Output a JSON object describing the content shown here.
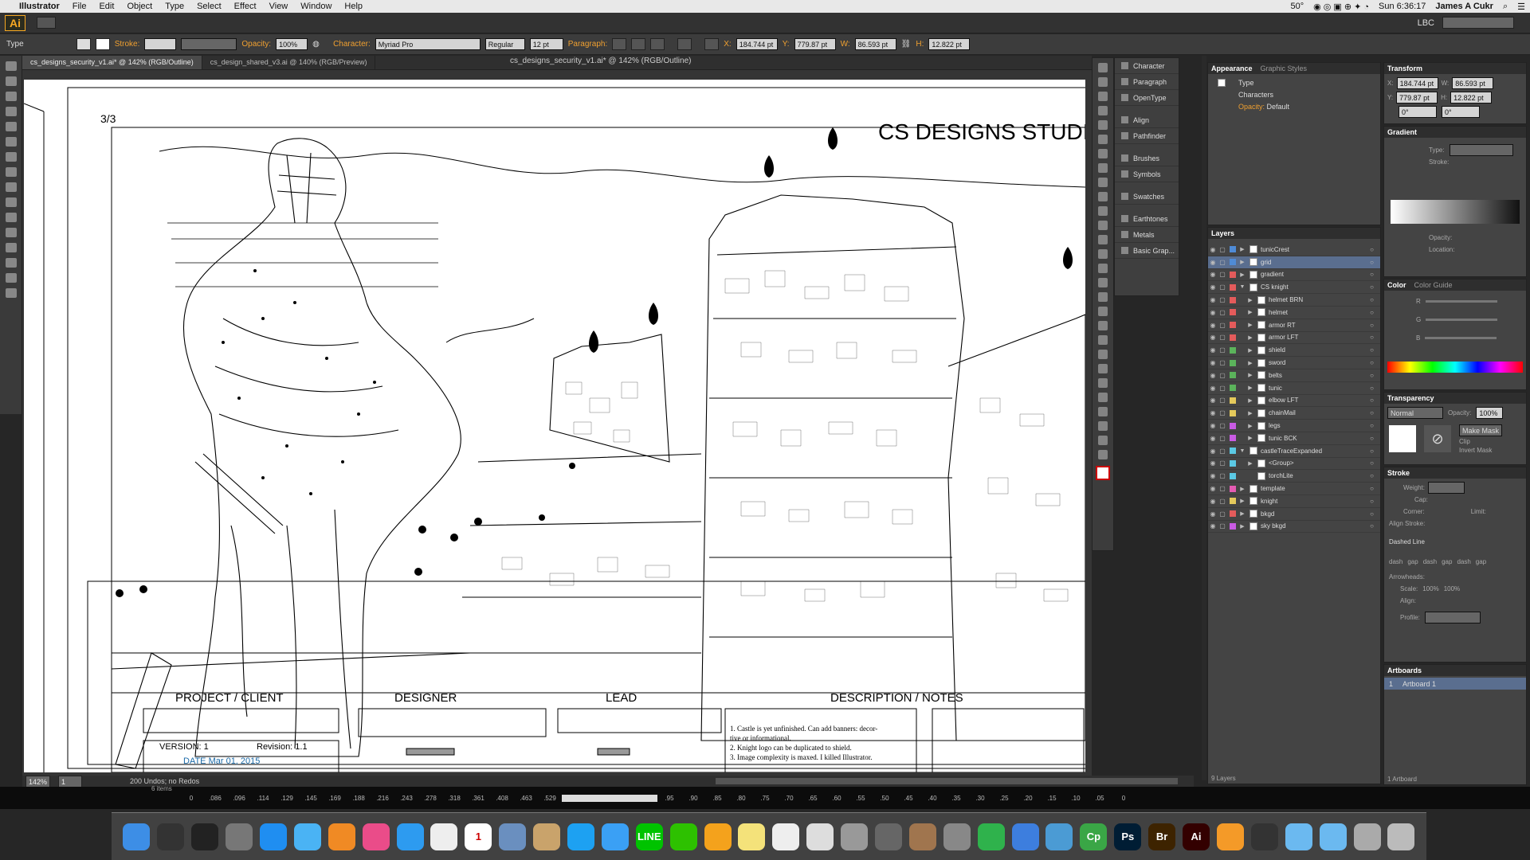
{
  "menubar": {
    "apple": "",
    "app": "Illustrator",
    "items": [
      "File",
      "Edit",
      "Object",
      "Type",
      "Select",
      "Effect",
      "View",
      "Window",
      "Help"
    ],
    "temp": "50°",
    "clock": "Sun 6:36:17",
    "user": "James A Cukr"
  },
  "appbar": {
    "logo": "Ai",
    "workspace": "LBC"
  },
  "control": {
    "tool": "Type",
    "stroke_label": "Stroke:",
    "opacity_label": "Opacity:",
    "opacity": "100%",
    "character_label": "Character:",
    "font": "Myriad Pro",
    "style": "Regular",
    "size": "12 pt",
    "paragraph_label": "Paragraph:",
    "x_label": "X:",
    "x": "184.744 pt",
    "y_label": "Y:",
    "y": "779.87 pt",
    "w_label": "W:",
    "w": "86.593 pt",
    "h_label": "H:",
    "h": "12.822 pt"
  },
  "tabs": [
    "cs_designs_security_v1.ai* @ 142% (RGB/Outline)",
    "cs_design_shared_v3.ai @ 140% (RGB/Preview)"
  ],
  "window_title": "cs_designs_security_v1.ai* @ 142% (RGB/Outline)",
  "artboard": {
    "page_num": "3/3",
    "studio": "CS DESIGNS STUDIOS",
    "project_header": "PROJECT / CLIENT",
    "designer_header": "DESIGNER",
    "lead_header": "LEAD",
    "desc_header": "DESCRIPTION / NOTES",
    "version": "VERSION: 1",
    "revision": "Revision: 1.1",
    "date": "DATE Mar 01, 2015",
    "note1": "1. Castle is yet unfinished. Can add banners: decor-",
    "note1b": "tive or informational.",
    "note2": "2. Knight logo can be duplicated to shield.",
    "note3": "3. Image complexity is maxed. I killed Illustrator."
  },
  "mini_panels": [
    "Character",
    "Paragraph",
    "OpenType",
    "Align",
    "Pathfinder",
    "Brushes",
    "Symbols",
    "Swatches",
    "Earthtones",
    "Metals",
    "Basic Grap..."
  ],
  "appearance": {
    "tabs": [
      "Appearance",
      "Graphic Styles"
    ],
    "type": "Type",
    "characters": "Characters",
    "opacity_label": "Opacity:",
    "opacity": "Default"
  },
  "layers": {
    "title": "Layers",
    "count": "9 Layers",
    "items": [
      {
        "name": "tunicCrest",
        "indent": 0,
        "color": "#4f8bd6",
        "tri": "▶"
      },
      {
        "name": "grid",
        "indent": 0,
        "color": "#4f8bd6",
        "tri": "▶",
        "sel": true
      },
      {
        "name": "gradient",
        "indent": 0,
        "color": "#e45b5b",
        "tri": "▶"
      },
      {
        "name": "CS knight",
        "indent": 0,
        "color": "#e45b5b",
        "tri": "▼"
      },
      {
        "name": "helmet BRN",
        "indent": 1,
        "color": "#e45b5b",
        "tri": "▶"
      },
      {
        "name": "helmet",
        "indent": 1,
        "color": "#e45b5b",
        "tri": "▶"
      },
      {
        "name": "armor RT",
        "indent": 1,
        "color": "#e45b5b",
        "tri": "▶"
      },
      {
        "name": "armor LFT",
        "indent": 1,
        "color": "#e45b5b",
        "tri": "▶"
      },
      {
        "name": "shield",
        "indent": 1,
        "color": "#5bb35b",
        "tri": "▶"
      },
      {
        "name": "sword",
        "indent": 1,
        "color": "#5bb35b",
        "tri": "▶"
      },
      {
        "name": "belts",
        "indent": 1,
        "color": "#5bb35b",
        "tri": "▶"
      },
      {
        "name": "tunic",
        "indent": 1,
        "color": "#5bb35b",
        "tri": "▶"
      },
      {
        "name": "elbow LFT",
        "indent": 1,
        "color": "#e4c95b",
        "tri": "▶"
      },
      {
        "name": "chainMail",
        "indent": 1,
        "color": "#e4c95b",
        "tri": "▶"
      },
      {
        "name": "legs",
        "indent": 1,
        "color": "#c95be4",
        "tri": "▶"
      },
      {
        "name": "tunic BCK",
        "indent": 1,
        "color": "#c95be4",
        "tri": "▶"
      },
      {
        "name": "castleTraceExpanded",
        "indent": 0,
        "color": "#5bc9e4",
        "tri": "▼"
      },
      {
        "name": "<Group>",
        "indent": 1,
        "color": "#5bc9e4",
        "tri": "▶"
      },
      {
        "name": "torchLite",
        "indent": 1,
        "color": "#5bc9e4",
        "tri": ""
      },
      {
        "name": "template",
        "indent": 0,
        "color": "#e45bb3",
        "tri": "▶"
      },
      {
        "name": "knight",
        "indent": 0,
        "color": "#e4c95b",
        "tri": "▶"
      },
      {
        "name": "bkgd",
        "indent": 0,
        "color": "#e45b5b",
        "tri": "▶"
      },
      {
        "name": "sky bkgd",
        "indent": 0,
        "color": "#c95be4",
        "tri": "▶"
      }
    ]
  },
  "transform": {
    "title": "Transform",
    "x_label": "X:",
    "x": "184.744 pt",
    "w_label": "W:",
    "w": "86.593 pt",
    "y_label": "Y:",
    "y": "779.87 pt",
    "h_label": "H:",
    "h": "12.822 pt",
    "rot": "0°",
    "shear": "0°"
  },
  "gradient": {
    "title": "Gradient",
    "type_label": "Type:",
    "stroke_label": "Stroke:",
    "opacity_label": "Opacity:",
    "location_label": "Location:"
  },
  "color": {
    "tabs": [
      "Color",
      "Color Guide"
    ],
    "r": "R",
    "g": "G",
    "b": "B"
  },
  "transparency": {
    "title": "Transparency",
    "mode": "Normal",
    "opacity_label": "Opacity:",
    "opacity": "100%",
    "make_mask": "Make Mask",
    "clip": "Clip",
    "invert": "Invert Mask"
  },
  "stroke": {
    "title": "Stroke",
    "weight": "Weight:",
    "cap": "Cap:",
    "corner": "Corner:",
    "limit": "Limit:",
    "align": "Align Stroke:",
    "dashed": "Dashed Line",
    "dash": "dash",
    "gap": "gap",
    "arrowheads": "Arrowheads:",
    "scale": "Scale:",
    "scale_v": "100%",
    "align2": "Align:",
    "profile": "Profile:"
  },
  "artboards": {
    "title": "Artboards",
    "num": "1",
    "name": "Artboard 1",
    "count": "1 Artboard"
  },
  "status": {
    "zoom": "142%",
    "page": "1",
    "undos": "200 Undos; no Redos",
    "items": "6 items"
  },
  "ruler": [
    ".086",
    ".096",
    ".114",
    ".129",
    ".145",
    ".169",
    ".188",
    ".216",
    ".243",
    ".278",
    ".318",
    ".361",
    ".408",
    ".463",
    ".529",
    "",
    "",
    "",
    "",
    ".95",
    ".90",
    ".85",
    ".80",
    ".75",
    ".70",
    ".65",
    ".60",
    ".55",
    ".50",
    ".45",
    ".40",
    ".35",
    ".30",
    ".25",
    ".20",
    ".15",
    ".10",
    ".05",
    "0"
  ],
  "ruler_start": "0",
  "dock": [
    {
      "name": "finder",
      "color": "#3d8ee6",
      "g": ""
    },
    {
      "name": "activity",
      "color": "#333",
      "g": ""
    },
    {
      "name": "time-machine",
      "color": "#222",
      "g": ""
    },
    {
      "name": "launchpad",
      "color": "#777",
      "g": ""
    },
    {
      "name": "app-store",
      "color": "#1f8ef1",
      "g": ""
    },
    {
      "name": "weather",
      "color": "#4ab3f4",
      "g": ""
    },
    {
      "name": "books",
      "color": "#f08a24",
      "g": ""
    },
    {
      "name": "itunes",
      "color": "#ea4c89",
      "g": ""
    },
    {
      "name": "safari",
      "color": "#2d9bf0",
      "g": ""
    },
    {
      "name": "reminders",
      "color": "#eee",
      "g": ""
    },
    {
      "name": "calendar",
      "color": "#fff",
      "g": "1"
    },
    {
      "name": "preview",
      "color": "#6a8fbf",
      "g": ""
    },
    {
      "name": "notes",
      "color": "#c9a36b",
      "g": ""
    },
    {
      "name": "twitter",
      "color": "#1da1f2",
      "g": ""
    },
    {
      "name": "messages",
      "color": "#3aa0f5",
      "g": ""
    },
    {
      "name": "line",
      "color": "#00c300",
      "g": "LINE"
    },
    {
      "name": "wechat",
      "color": "#2dc100",
      "g": ""
    },
    {
      "name": "vlc",
      "color": "#f4a21c",
      "g": ""
    },
    {
      "name": "stickies",
      "color": "#f4e27a",
      "g": ""
    },
    {
      "name": "textedit",
      "color": "#eee",
      "g": ""
    },
    {
      "name": "photos",
      "color": "#ddd",
      "g": ""
    },
    {
      "name": "camera",
      "color": "#999",
      "g": ""
    },
    {
      "name": "scanner",
      "color": "#666",
      "g": ""
    },
    {
      "name": "image-capture",
      "color": "#a0754e",
      "g": ""
    },
    {
      "name": "automator",
      "color": "#888",
      "g": ""
    },
    {
      "name": "numbers",
      "color": "#2fb24c",
      "g": ""
    },
    {
      "name": "keynote",
      "color": "#3d7ede",
      "g": ""
    },
    {
      "name": "fireworks",
      "color": "#4b9bd4",
      "g": ""
    },
    {
      "name": "copy",
      "color": "#3aa646",
      "g": "Cp"
    },
    {
      "name": "photoshop",
      "color": "#001d34",
      "g": "Ps"
    },
    {
      "name": "bridge",
      "color": "#3d2300",
      "g": "Br"
    },
    {
      "name": "illustrator",
      "color": "#330000",
      "g": "Ai"
    },
    {
      "name": "pages",
      "color": "#f49a28",
      "g": ""
    },
    {
      "name": "home",
      "color": "#333",
      "g": ""
    },
    {
      "name": "applications",
      "color": "#6bb9f0",
      "g": ""
    },
    {
      "name": "folder",
      "color": "#6bb9f0",
      "g": ""
    },
    {
      "name": "downloads",
      "color": "#aaa",
      "g": ""
    },
    {
      "name": "trash",
      "color": "#bbb",
      "g": ""
    }
  ]
}
